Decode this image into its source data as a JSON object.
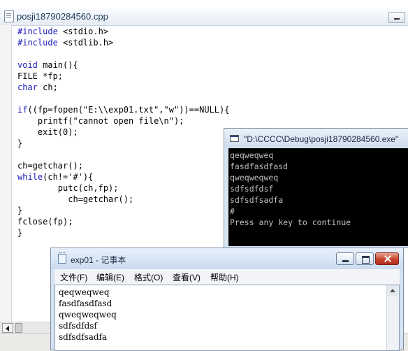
{
  "ide": {
    "title": "posji18790284560.cpp",
    "code_lines": [
      [
        {
          "t": "#include",
          "k": true
        },
        {
          "t": " <stdio.h>",
          "k": false
        }
      ],
      [
        {
          "t": "#include",
          "k": true
        },
        {
          "t": " <stdlib.h>",
          "k": false
        }
      ],
      [],
      [
        {
          "t": "void",
          "k": true
        },
        {
          "t": " main(){",
          "k": false
        }
      ],
      [
        {
          "t": "FILE *fp;",
          "k": false
        }
      ],
      [
        {
          "t": "char",
          "k": true
        },
        {
          "t": " ch;",
          "k": false
        }
      ],
      [],
      [
        {
          "t": "if",
          "k": true
        },
        {
          "t": "((fp=fopen(\"E:\\\\exp01.txt\",\"w\"))==NULL){",
          "k": false
        }
      ],
      [
        {
          "t": "    printf(\"cannot open file\\n\");",
          "k": false
        }
      ],
      [
        {
          "t": "    exit(0);",
          "k": false
        }
      ],
      [
        {
          "t": "}",
          "k": false
        }
      ],
      [],
      [
        {
          "t": "ch=getchar();",
          "k": false
        }
      ],
      [
        {
          "t": "while",
          "k": true
        },
        {
          "t": "(ch!='#'){",
          "k": false
        }
      ],
      [
        {
          "t": "        putc(ch,fp);",
          "k": false
        }
      ],
      [
        {
          "t": "          ch=getchar();",
          "k": false
        }
      ],
      [
        {
          "t": "}",
          "k": false
        }
      ],
      [
        {
          "t": "fclose(fp);",
          "k": false
        }
      ],
      [
        {
          "t": "}",
          "k": false
        }
      ]
    ]
  },
  "console": {
    "title": "\"D:\\CCCC\\Debug\\posji18790284560.exe\"",
    "lines": [
      "qeqweqweq",
      "fasdfasdfasd",
      "qweqweqweq",
      "sdfsdfdsf",
      "sdfsdfsadfa",
      "#",
      "Press any key to continue"
    ]
  },
  "notepad": {
    "title": "exp01 - 记事本",
    "menu": [
      "文件(F)",
      "编辑(E)",
      "格式(O)",
      "查看(V)",
      "帮助(H)"
    ],
    "lines": [
      "qeqweqweq",
      "fasdfasdfasd",
      "qweqweqweq",
      "sdfsdfdsf",
      "sdfsdfsadfa"
    ]
  },
  "colors": {
    "keyword": "#1a1ab8",
    "console_bg": "#000000",
    "console_text": "#c0c0c0",
    "close_button": "#c7442b"
  }
}
